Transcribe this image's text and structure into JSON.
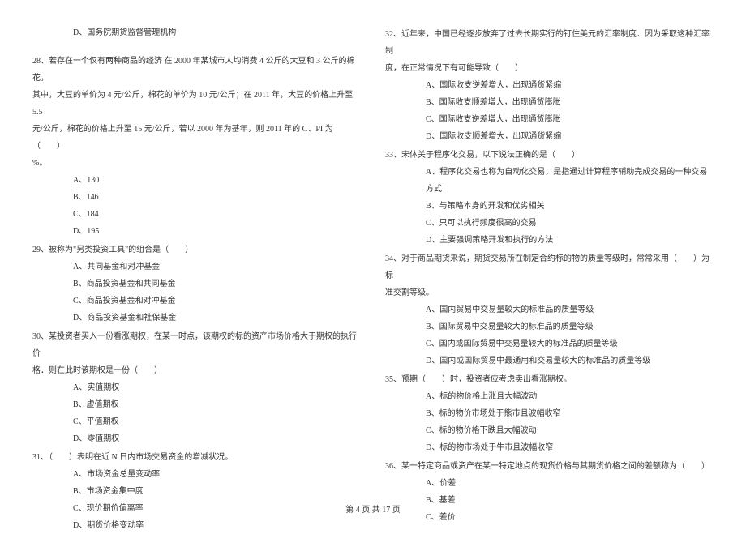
{
  "left": {
    "line_d_27": "D、国务院期货监督管理机构",
    "q28_line1": "28、若存在一个仅有两种商品的经济 在 2000 年某城市人均消费 4 公斤的大豆和 3 公斤的棉花，",
    "q28_line2": "其中，大豆的单价为 4 元/公斤，棉花的单价为 10 元/公斤；在 2011 年，大豆的价格上升至 5.5",
    "q28_line3": "元/公斤，棉花的价格上升至 15 元/公斤，若以 2000 年为基年，则 2011 年的 C、PI 为（　　）",
    "q28_line4": "%。",
    "q28_a": "A、130",
    "q28_b": "B、146",
    "q28_c": "C、184",
    "q28_d": "D、195",
    "q29": "29、被称为\"另类投资工具\"的组合是（　　）",
    "q29_a": "A、共同基金和对冲基金",
    "q29_b": "B、商品投资基金和共同基金",
    "q29_c": "C、商品投资基金和对冲基金",
    "q29_d": "D、商品投资基金和社保基金",
    "q30_line1": "30、某投资者买入一份看涨期权，在某一时点，该期权的标的资产市场价格大于期权的执行价",
    "q30_line2": "格．则在此时该期权是一份（　　）",
    "q30_a": "A、实值期权",
    "q30_b": "B、虚值期权",
    "q30_c": "C、平值期权",
    "q30_d": "D、零值期权",
    "q31": "31、（　　）表明在近 N 日内市场交易资金的增减状况。",
    "q31_a": "A、市场资金总量变动率",
    "q31_b": "B、市场资金集中度",
    "q31_c": "C、现价期价偏离率",
    "q31_d": "D、期货价格变动率"
  },
  "right": {
    "q32_line1": "32、近年来，中国已经逐步放弃了过去长期实行的钉住美元的汇率制度．因为采取这种汇率制",
    "q32_line2": "度，在正常情况下有可能导致（　　）",
    "q32_a": "A、国际收支逆差增大，出现通货紧缩",
    "q32_b": "B、国际收支顺差增大，出现通货膨胀",
    "q32_c": "C、国际收支逆差增大，出现通货膨胀",
    "q32_d": "D、国际收支顺差增大，出现通货紧缩",
    "q33": "33、宋体关于程序化交易，以下说法正确的是（　　）",
    "q33_a": "A、程序化交易也称为自动化交易，是指通过计算程序辅助完成交易的一种交易方式",
    "q33_b": "B、与策略本身的开发和优劣相关",
    "q33_c": "C、只可以执行频度很高的交易",
    "q33_d": "D、主要强调策略开发和执行的方法",
    "q34_line1": "34、对于商品期货来说，期货交易所在制定合约标的物的质量等级时，常常采用（　　）为标",
    "q34_line2": "准交割等级。",
    "q34_a": "A、国内贸易中交易量较大的标准品的质量等级",
    "q34_b": "B、国际贸易中交易量较大的标准品的质量等级",
    "q34_c": "C、国内或国际贸易中交易量较大的标准品的质量等级",
    "q34_d": "D、国内或国际贸易中最通用和交易量较大的标准品的质量等级",
    "q35": "35、预期（　　）时，投资者应考虑卖出看涨期权。",
    "q35_a": "A、标的物价格上涨且大幅波动",
    "q35_b": "B、标的物价市场处于熊市且波幅收窄",
    "q35_c": "C、标的物价格下跌且大幅波动",
    "q35_d": "D、标的物市场处于牛市且波幅收窄",
    "q36": "36、某一特定商品或资产在某一特定地点的现货价格与其期货价格之间的差额称为（　　）",
    "q36_a": "A、价差",
    "q36_b": "B、基差",
    "q36_c": "C、差价"
  },
  "footer": "第 4 页 共 17 页"
}
